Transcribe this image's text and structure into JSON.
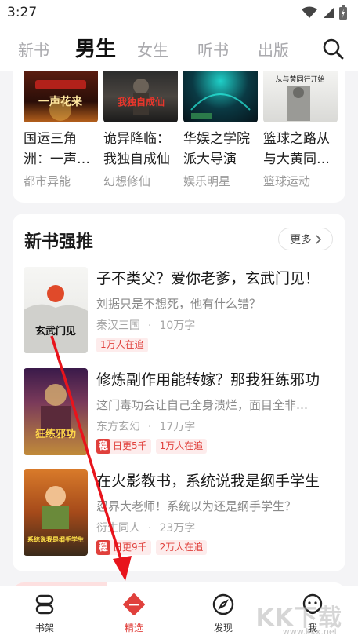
{
  "status_bar": {
    "time": "3:27"
  },
  "top_tabs": [
    {
      "label": "新书",
      "active": false
    },
    {
      "label": "男生",
      "active": true
    },
    {
      "label": "女生",
      "active": false
    },
    {
      "label": "听书",
      "active": false
    },
    {
      "label": "出版",
      "active": false
    }
  ],
  "grid_books": [
    {
      "title": "国运三角洲：一声…",
      "category": "都市异能",
      "cover_text": "一声花来"
    },
    {
      "title": "诡异降临：我独自成仙",
      "category": "幻想修仙",
      "cover_text": "我独自成仙"
    },
    {
      "title": "华娱之学院派大导演",
      "category": "娱乐明星",
      "cover_text": ""
    },
    {
      "title": "篮球之路从与大黄同…",
      "category": "篮球运动",
      "cover_text": "从与黄同行开始"
    }
  ],
  "recommend": {
    "title": "新书强推",
    "more_label": "更多",
    "books": [
      {
        "title": "子不类父？爱你老爹，玄武门见！",
        "desc": "刘据只是不想死，他有什么错？",
        "category": "秦汉三国",
        "words": "10万字",
        "tags": [
          "1万人在追"
        ],
        "has_wen": false,
        "daily": "",
        "cover_text": "玄武门见"
      },
      {
        "title": "修炼副作用能转嫁？那我狂练邪功",
        "desc": "这门毒功会让自己全身溃烂，面目全非…",
        "category": "东方玄幻",
        "words": "17万字",
        "tags": [
          "1万人在追"
        ],
        "has_wen": true,
        "wen_label": "稳",
        "daily": "日更5千",
        "cover_text": "狂练邪功"
      },
      {
        "title": "在火影教书，系统说我是纲手学生",
        "desc": "忍界大老师！系统以为还是纲手学生？",
        "category": "衍生同人",
        "words": "23万字",
        "tags": [
          "2万人在追"
        ],
        "has_wen": true,
        "wen_label": "稳",
        "daily": "日更9千",
        "cover_text": "系统说我是纲手学生"
      }
    ]
  },
  "bottom_nav": [
    {
      "label": "书架",
      "icon": "bookshelf-icon",
      "active": false
    },
    {
      "label": "精选",
      "icon": "featured-icon",
      "active": true
    },
    {
      "label": "发现",
      "icon": "compass-icon",
      "active": false
    },
    {
      "label": "我",
      "icon": "profile-icon",
      "active": false
    }
  ],
  "watermark": {
    "text": "KK下载",
    "url": "www.kkx.net"
  },
  "colors": {
    "accent": "#e0403c",
    "annotation_arrow": "#e8141c"
  }
}
